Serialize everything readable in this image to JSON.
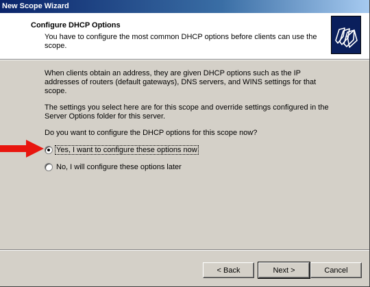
{
  "window": {
    "title": "New Scope Wizard"
  },
  "header": {
    "title": "Configure DHCP Options",
    "subtitle": "You have to configure the most common DHCP options before clients can use the scope.",
    "icon": "wizard-folders-icon"
  },
  "body": {
    "paragraph1": "When clients obtain an address, they are given DHCP options such as the IP addresses of routers (default gateways), DNS servers, and WINS settings for that scope.",
    "paragraph2": "The settings you select here are for this scope and override settings configured in the Server Options folder for this server.",
    "question": "Do you want to configure the DHCP options for this scope now?",
    "options": [
      {
        "label": "Yes, I want to configure these options now",
        "selected": true
      },
      {
        "label": "No, I will configure these options later",
        "selected": false
      }
    ],
    "annotation_arrow_color": "#e8160f"
  },
  "buttons": {
    "back": "< Back",
    "next": "Next >",
    "cancel": "Cancel"
  }
}
